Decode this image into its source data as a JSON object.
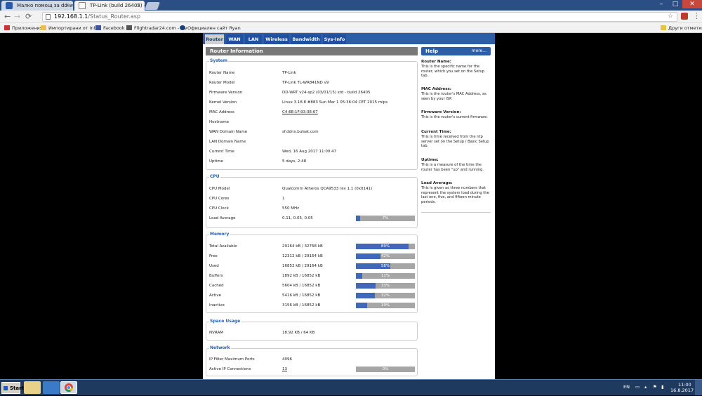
{
  "browser": {
    "tabs": [
      {
        "title": "Малко помощ за dd-wrt..."
      },
      {
        "title": "TP-Link (build 26405) - Ro"
      }
    ],
    "url_host": "192.168.1.1",
    "url_path": "/Status_Router.asp",
    "bookmarks": [
      "Приложения",
      "Импортирани от Inter",
      "Facebook",
      "Flightradar24.com - Liv",
      "Официален сайт Ryan"
    ],
    "other_bookmarks": "Други отметки"
  },
  "router": {
    "nav_tabs": [
      "Router",
      "WAN",
      "LAN",
      "Wireless",
      "Bandwidth",
      "Sys-Info"
    ],
    "page_header": "Router Information",
    "system": {
      "title": "System",
      "rows": [
        {
          "label": "Router Name",
          "value": "TP-Link"
        },
        {
          "label": "Router Model",
          "value": "TP-Link TL-WR841ND v9"
        },
        {
          "label": "Firmware Version",
          "value": "DD-WRT v24-sp2 (03/01/15) std - build 26405"
        },
        {
          "label": "Kernel Version",
          "value": "Linux 3.18.8 #883 Sun Mar 1 05:36:04 CET 2015 mips"
        },
        {
          "label": "MAC Address",
          "value": "C4:6E:1F:93:3E:67"
        },
        {
          "label": "Hostname",
          "value": ""
        },
        {
          "label": "WAN Domain Name",
          "value": "sf.ddns.bulsat.com"
        },
        {
          "label": "LAN Domain Name",
          "value": ""
        },
        {
          "label": "Current Time",
          "value": "Wed, 16 Aug 2017 11:00:47"
        },
        {
          "label": "Uptime",
          "value": "5 days, 2:48"
        }
      ]
    },
    "cpu": {
      "title": "CPU",
      "rows": [
        {
          "label": "CPU Model",
          "value": "Qualcomm Atheros QCA9533 rev 1.1 (0x0141)"
        },
        {
          "label": "CPU Cores",
          "value": "1"
        },
        {
          "label": "CPU Clock",
          "value": "550 MHz"
        },
        {
          "label": "Load Average",
          "value": "0.11, 0.05, 0.05",
          "percent": 7,
          "percent_label": "7%"
        }
      ]
    },
    "memory": {
      "title": "Memory",
      "rows": [
        {
          "label": "Total Available",
          "value": "29164 kB / 32768 kB",
          "percent": 89,
          "percent_label": "89%"
        },
        {
          "label": "Free",
          "value": "12312 kB / 29164 kB",
          "percent": 42,
          "percent_label": "42%"
        },
        {
          "label": "Used",
          "value": "16852 kB / 29164 kB",
          "percent": 58,
          "percent_label": "58%"
        },
        {
          "label": "Buffers",
          "value": "1892 kB / 16852 kB",
          "percent": 11,
          "percent_label": "11%"
        },
        {
          "label": "Cached",
          "value": "5604 kB / 16852 kB",
          "percent": 33,
          "percent_label": "33%"
        },
        {
          "label": "Active",
          "value": "5416 kB / 16852 kB",
          "percent": 32,
          "percent_label": "32%"
        },
        {
          "label": "Inactive",
          "value": "3156 kB / 16852 kB",
          "percent": 19,
          "percent_label": "19%"
        }
      ]
    },
    "space": {
      "title": "Space Usage",
      "rows": [
        {
          "label": "NVRAM",
          "value": "18.92 KB / 64 KB"
        }
      ]
    },
    "network": {
      "title": "Network",
      "rows": [
        {
          "label": "IP Filter Maximum Ports",
          "value": "4096"
        },
        {
          "label": "Active IP Connections",
          "value": "13",
          "percent": 0,
          "percent_label": "0%"
        }
      ]
    },
    "help": {
      "title": "Help",
      "more": "more...",
      "items": [
        {
          "title": "Router Name:",
          "text": "This is the specific name for the router, which you set on the Setup tab."
        },
        {
          "title": "MAC Address:",
          "text": "This is the router's MAC Address, as seen by your ISP."
        },
        {
          "title": "Firmware Version:",
          "text": "This is the router's current firmware."
        },
        {
          "title": "Current Time:",
          "text": "This is time received from the ntp server set on the Setup / Basic Setup tab."
        },
        {
          "title": "Uptime:",
          "text": "This is a measure of the time the router has been \"up\" and running."
        },
        {
          "title": "Load Average:",
          "text": "This is given as three numbers that represent the system load during the last one, five, and fifteen minute periods."
        }
      ]
    }
  },
  "taskbar": {
    "start": "Start",
    "lang": "EN",
    "time": "11:00",
    "date": "16.8.2017 г."
  }
}
